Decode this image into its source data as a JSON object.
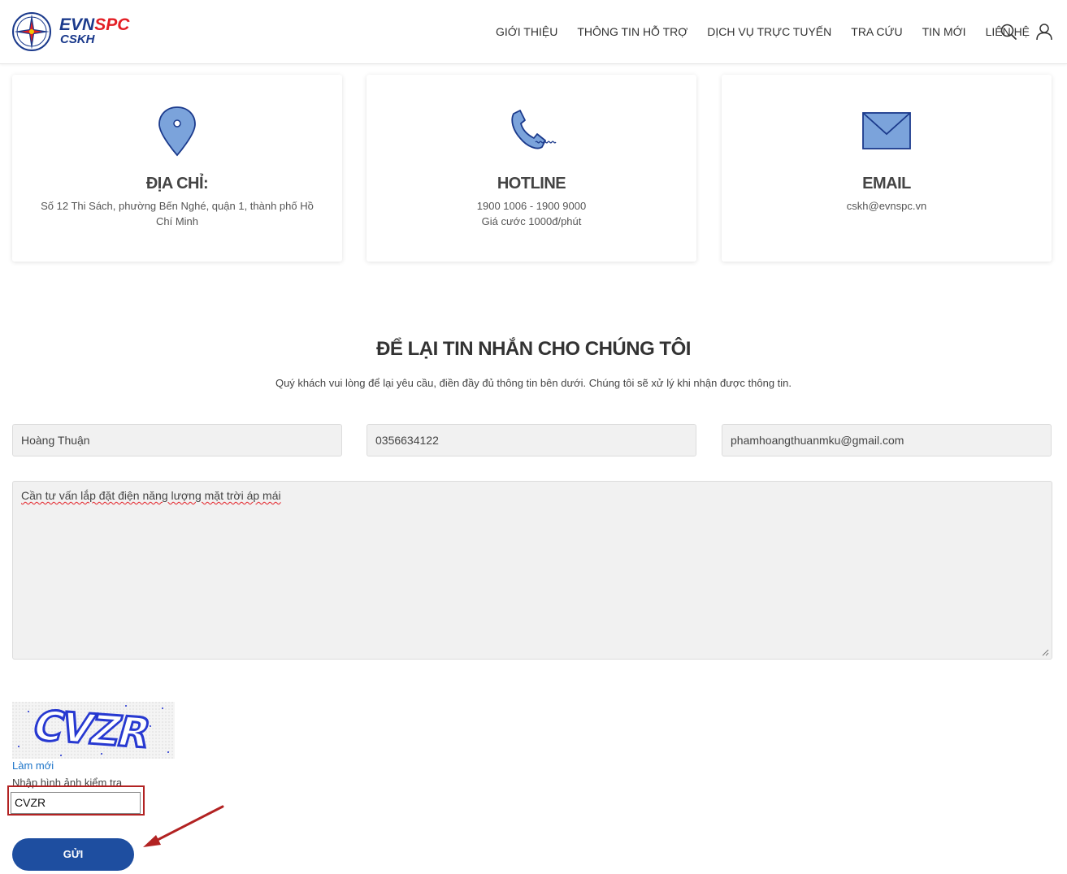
{
  "brand": {
    "evn": "EVN",
    "spc": "SPC",
    "sub": "CSKH",
    "colors": {
      "primary": "#1b3a8c",
      "red": "#e31e24",
      "button": "#1e4ea0"
    }
  },
  "nav": {
    "items": [
      {
        "label": "GIỚI THIỆU"
      },
      {
        "label": "THÔNG TIN HỖ TRỢ"
      },
      {
        "label": "DỊCH VỤ TRỰC TUYẾN"
      },
      {
        "label": "TRA CỨU"
      },
      {
        "label": "TIN MỚI"
      },
      {
        "label": "LIÊN HỆ"
      }
    ],
    "icons": {
      "search": "search-icon",
      "user": "user-icon"
    }
  },
  "cards": [
    {
      "icon": "location-pin-icon",
      "title": "ĐỊA CHỈ:",
      "line1": "Số 12 Thi Sách, phường Bến Nghé, quận 1, thành phố Hồ Chí Minh",
      "line2": ""
    },
    {
      "icon": "phone-icon",
      "title": "HOTLINE",
      "line1": "1900 1006 - 1900 9000",
      "line2": "Giá cước 1000đ/phút"
    },
    {
      "icon": "envelope-icon",
      "title": "EMAIL",
      "line1": "cskh@evnspc.vn",
      "line2": ""
    }
  ],
  "form": {
    "title": "ĐỂ LẠI TIN NHẮN CHO CHÚNG TÔI",
    "subtitle": "Quý khách vui lòng để lại yêu cầu, điền đầy đủ thông tin bên dưới. Chúng tôi sẽ xử lý khi nhận được thông tin.",
    "name_value": "Hoàng Thuận",
    "phone_value": "0356634122",
    "email_value": "phamhoangthuanmku@gmail.com",
    "message_value": "Cần tư vấn lắp đặt điện năng lượng mặt trời áp mái",
    "captcha_image_text": "CVZR",
    "refresh_label": "Làm mới",
    "captcha_label": "Nhập hình ảnh kiểm tra",
    "captcha_value": "CVZR",
    "submit_label": "GỬI"
  }
}
